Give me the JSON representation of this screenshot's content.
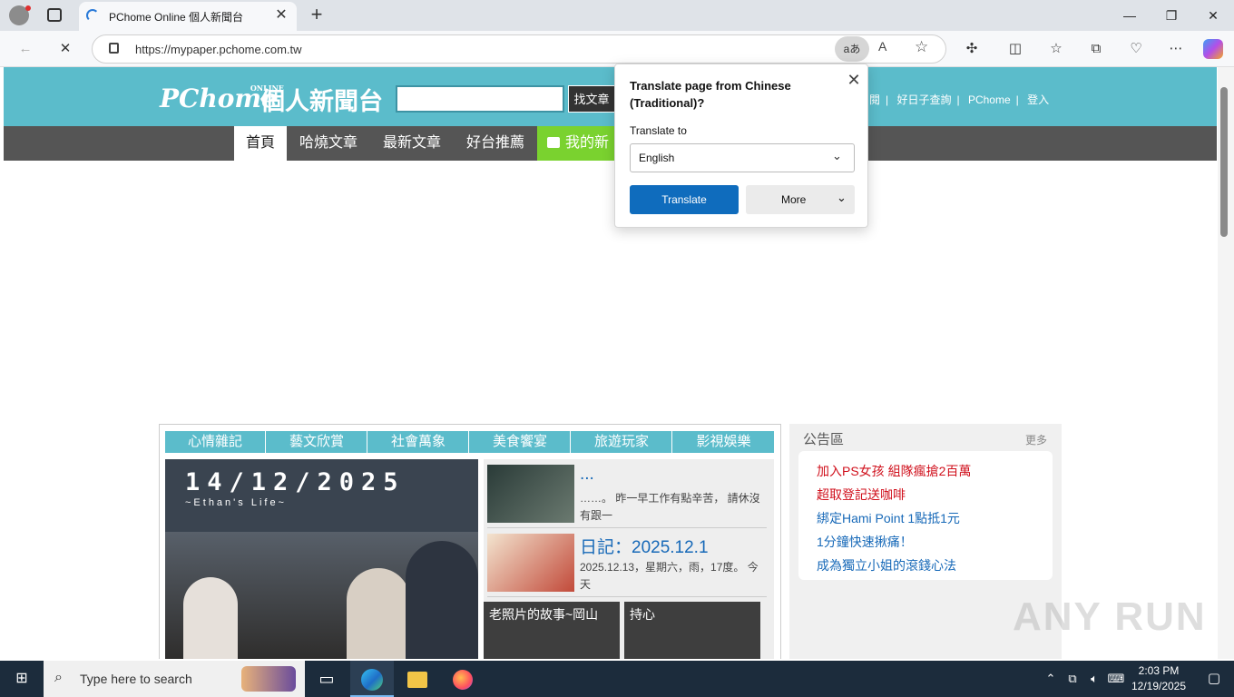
{
  "browser": {
    "tab_title": "PChome Online 個人新聞台",
    "url": "https://mypaper.pchome.com.tw",
    "translate_icon": "aあ"
  },
  "site": {
    "logo": "PChome",
    "logo_small": "ONLINE",
    "title": "個人新聞台",
    "search_button": "找文章",
    "top_links": [
      "閱",
      "好日子查詢",
      "PChome",
      "登入"
    ],
    "nav": [
      "首頁",
      "哈燒文章",
      "最新文章",
      "好台推薦",
      "我的新"
    ],
    "categories": [
      "心情雜記",
      "藝文欣賞",
      "社會萬象",
      "美食饗宴",
      "旅遊玩家",
      "影視娛樂"
    ],
    "feature": {
      "date": "14/12/2025",
      "subtitle": "~Ethan's Life~"
    },
    "articles": [
      {
        "title": "...",
        "body": "……。 昨一早工作有點辛苦， 請休沒有跟一"
      },
      {
        "title": "日記：2025.12.1",
        "body": "2025.12.13，星期六，雨，17度。 今天"
      }
    ],
    "pair_titles": [
      "老照片的故事~岡山",
      "持心"
    ],
    "sidebar": {
      "title": "公告區",
      "more": "更多",
      "items": [
        {
          "text": "加入PS女孩 組隊瘋搶2百萬",
          "color": "#d0101c"
        },
        {
          "text": "超取登記送咖啡",
          "color": "#d0101c"
        },
        {
          "text": "綁定Hami Point 1點抵1元",
          "color": "#1769b8"
        },
        {
          "text": "1分鐘快速揪痛！",
          "color": "#1769b8"
        },
        {
          "text": "成為獨立小姐的滾錢心法",
          "color": "#1769b8"
        }
      ]
    }
  },
  "translate_popup": {
    "title": "Translate page from Chinese (Traditional)?",
    "label": "Translate to",
    "selected_language": "English",
    "translate_button": "Translate",
    "more_button": "More"
  },
  "taskbar": {
    "search_placeholder": "Type here to search",
    "time": "2:03 PM",
    "date": "12/19/2025"
  }
}
